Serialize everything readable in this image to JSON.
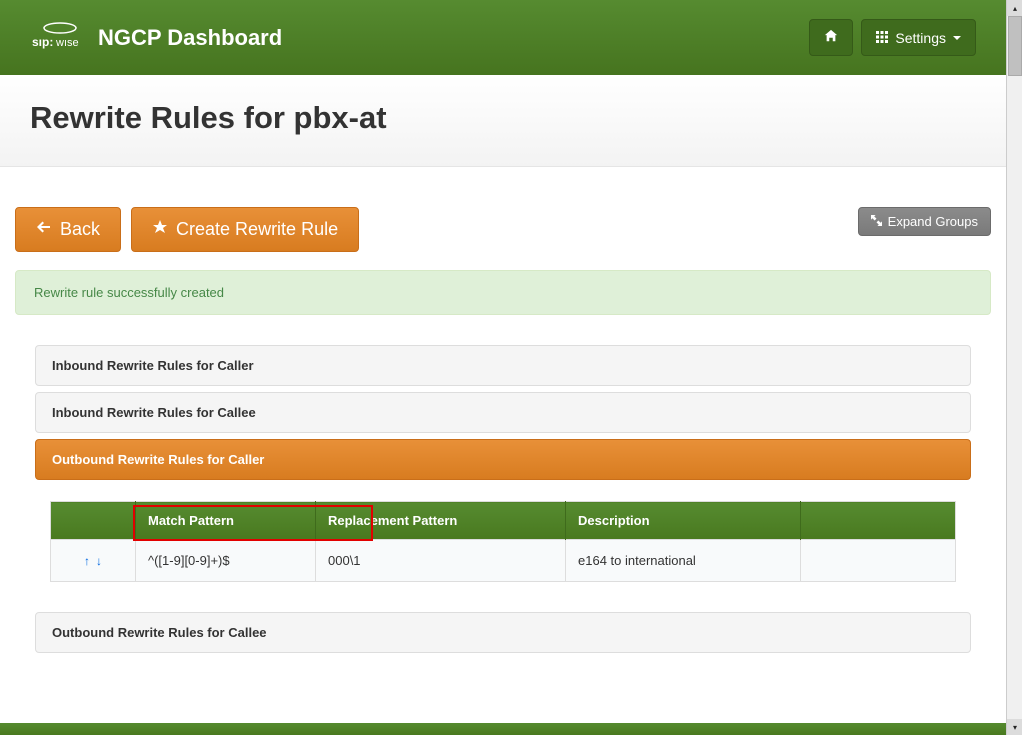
{
  "header": {
    "brand_title": "NGCP Dashboard",
    "settings_label": "Settings"
  },
  "page": {
    "title": "Rewrite Rules for pbx-at"
  },
  "actions": {
    "back_label": "Back",
    "create_label": "Create Rewrite Rule",
    "expand_label": "Expand Groups"
  },
  "alert": {
    "message": "Rewrite rule successfully created"
  },
  "panels": {
    "inbound_caller": "Inbound Rewrite Rules for Caller",
    "inbound_callee": "Inbound Rewrite Rules for Callee",
    "outbound_caller": "Outbound Rewrite Rules for Caller",
    "outbound_callee": "Outbound Rewrite Rules for Callee"
  },
  "table": {
    "headers": {
      "match": "Match Pattern",
      "replacement": "Replacement Pattern",
      "description": "Description"
    },
    "rows": [
      {
        "match": "^([1-9][0-9]+)$",
        "replacement": "000\\1",
        "description": "e164 to international"
      }
    ]
  }
}
